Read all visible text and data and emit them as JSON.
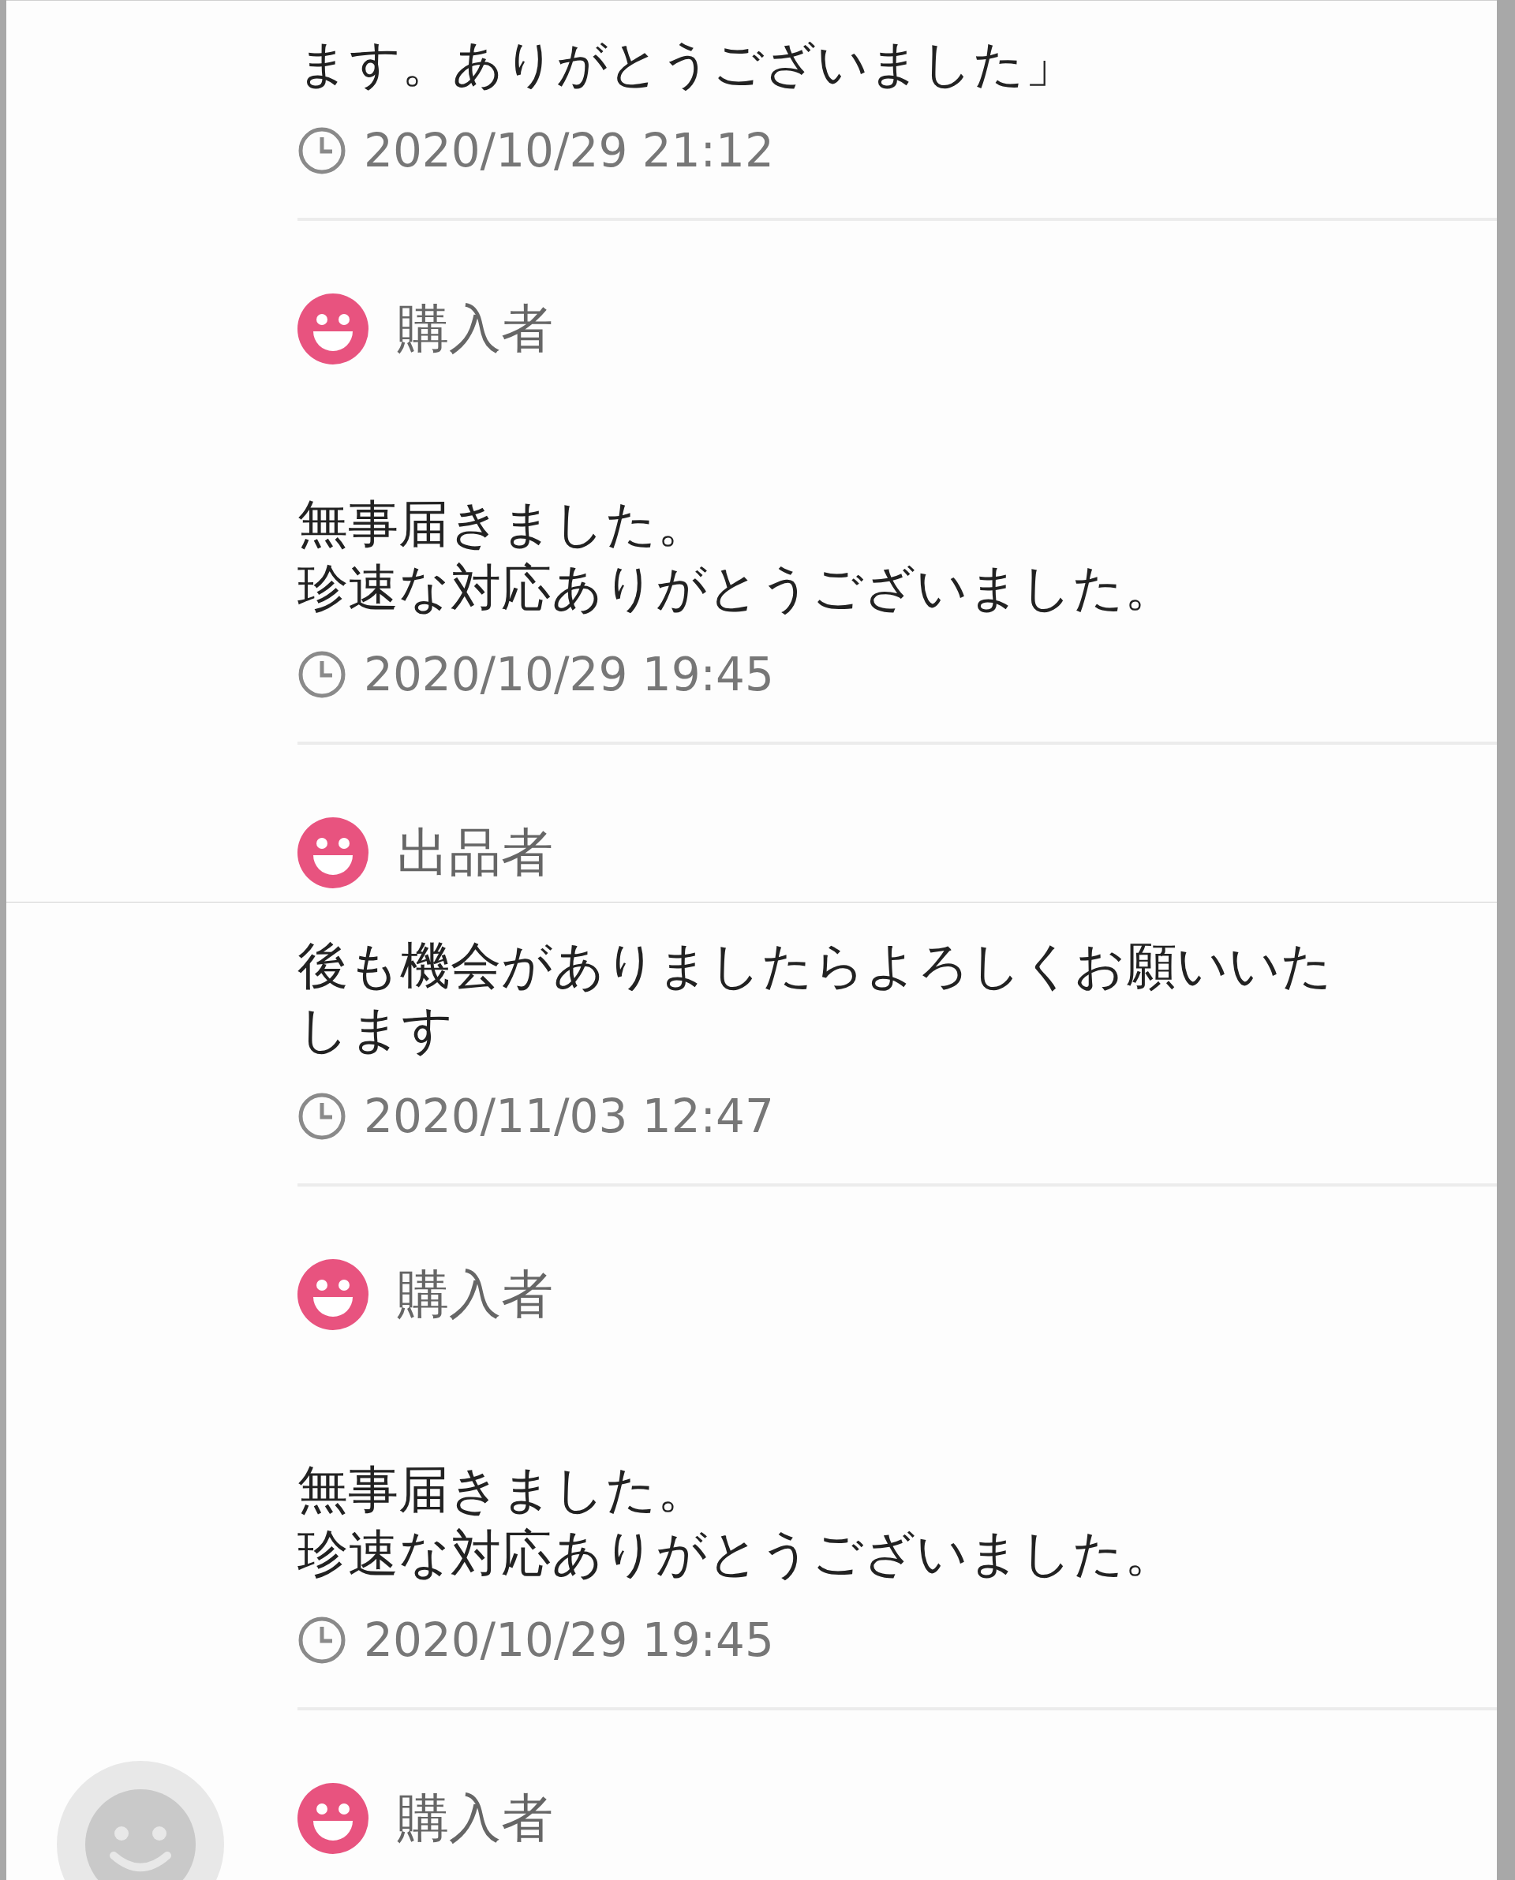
{
  "panels": [
    {
      "entries": [
        {
          "lines": [
            "ます。ありがとうございました」"
          ],
          "time": "2020/10/29 21:12"
        },
        {
          "role": "購入者",
          "avatar": false,
          "lines": [
            "無事届きました。",
            "珍速な対応ありがとうございました。"
          ],
          "time": "2020/10/29 19:45"
        },
        {
          "role": "出品者",
          "avatar": false
        }
      ]
    },
    {
      "entries": [
        {
          "lines": [
            "後も機会がありましたらよろしくお願いいた",
            "します"
          ],
          "time": "2020/11/03 12:47"
        },
        {
          "role": "購入者",
          "avatar": false,
          "lines": [
            "無事届きました。",
            "珍速な対応ありがとうございました。"
          ],
          "time": "2020/10/29 19:45"
        },
        {
          "role": "購入者",
          "avatar": true
        }
      ]
    }
  ]
}
